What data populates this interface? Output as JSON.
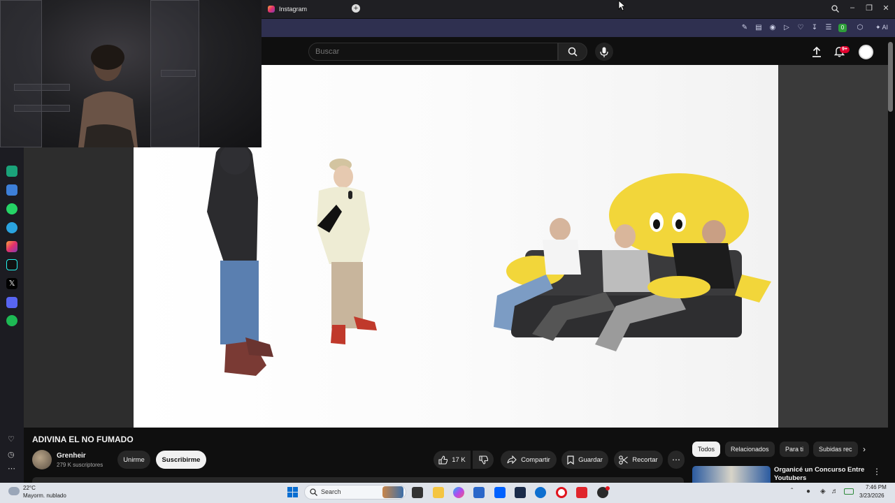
{
  "browser": {
    "tab_title": "Instagram",
    "new_tab_label": "+",
    "ai_label": "AI",
    "ext_badge": "0"
  },
  "youtube": {
    "search_placeholder": "Buscar",
    "notifications_badge": "9+",
    "video_title": "ADIVINA EL NO FUMADO",
    "channel_name": "Grenheir",
    "subscribers": "279 K suscriptores",
    "join_label": "Unirme",
    "subscribe_label": "Suscribirme",
    "likes": "17 K",
    "share_label": "Compartir",
    "save_label": "Guardar",
    "clip_label": "Recortar",
    "chips": [
      "Todos",
      "Relacionados",
      "Para ti",
      "Subidas rec"
    ],
    "recommended_title": "Organicé un Concurso Entre Youtubers"
  },
  "taskbar": {
    "temperature": "22°C",
    "weather": "Mayorm. nublado",
    "search_label": "Search",
    "time": "7:46 PM",
    "date": "3/23/2026"
  },
  "colors": {
    "accent_red": "#e1002d",
    "youtube_bg": "#0f0f0f",
    "addressbar": "#2f3050"
  }
}
